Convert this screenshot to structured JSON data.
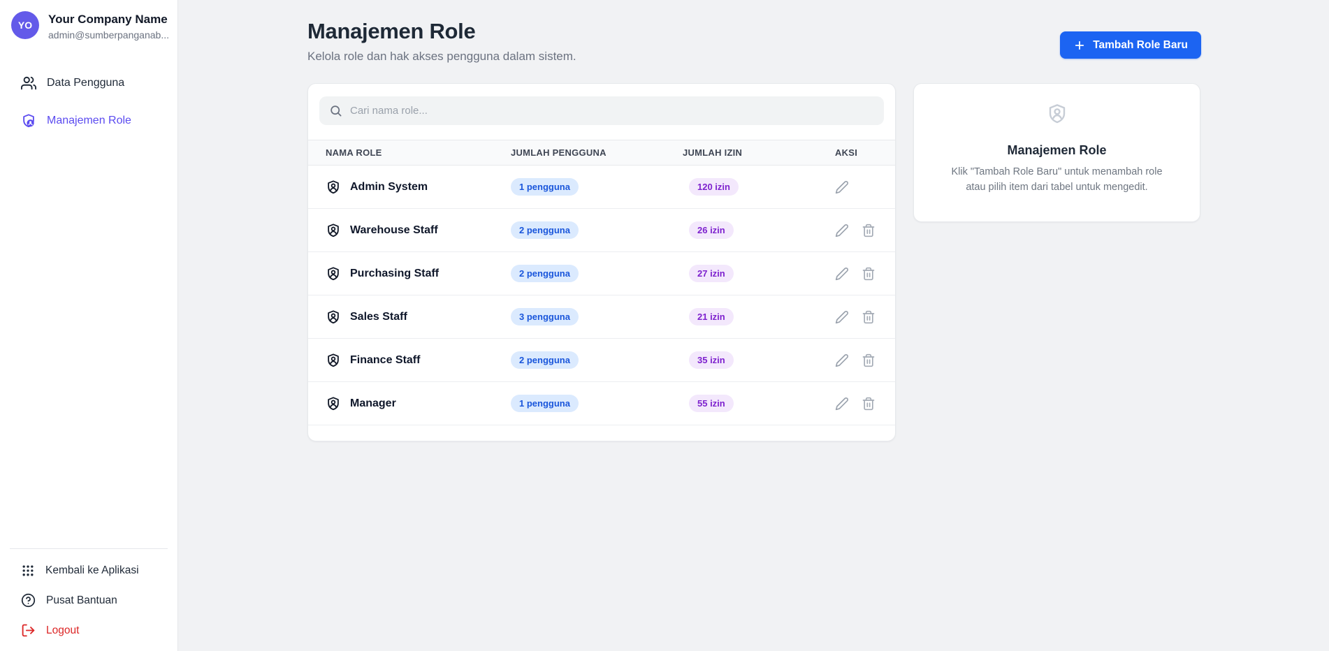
{
  "sidebar": {
    "profile": {
      "initials": "YO",
      "company_name": "Your Company Name",
      "email": "admin@sumberpanganab..."
    },
    "nav": [
      {
        "label": "Data Pengguna",
        "icon": "users-icon",
        "active": false
      },
      {
        "label": "Manajemen Role",
        "icon": "shield-user-icon",
        "active": true
      }
    ],
    "footer": [
      {
        "label": "Kembali ke Aplikasi",
        "icon": "grid-icon"
      },
      {
        "label": "Pusat Bantuan",
        "icon": "help-icon"
      },
      {
        "label": "Logout",
        "icon": "logout-icon"
      }
    ]
  },
  "header": {
    "title": "Manajemen Role",
    "subtitle": "Kelola role dan hak akses pengguna dalam sistem.",
    "add_button_label": "Tambah Role Baru"
  },
  "table": {
    "search_placeholder": "Cari nama role...",
    "columns": [
      "NAMA ROLE",
      "JUMLAH PENGGUNA",
      "JUMLAH IZIN",
      "AKSI"
    ],
    "rows": [
      {
        "name": "Admin System",
        "users": "1 pengguna",
        "permissions": "120 izin",
        "can_delete": false
      },
      {
        "name": "Warehouse Staff",
        "users": "2 pengguna",
        "permissions": "26 izin",
        "can_delete": true
      },
      {
        "name": "Purchasing Staff",
        "users": "2 pengguna",
        "permissions": "27 izin",
        "can_delete": true
      },
      {
        "name": "Sales Staff",
        "users": "3 pengguna",
        "permissions": "21 izin",
        "can_delete": true
      },
      {
        "name": "Finance Staff",
        "users": "2 pengguna",
        "permissions": "35 izin",
        "can_delete": true
      },
      {
        "name": "Manager",
        "users": "1 pengguna",
        "permissions": "55 izin",
        "can_delete": true
      }
    ]
  },
  "info_panel": {
    "title": "Manajemen Role",
    "description": "Klik \"Tambah Role Baru\" untuk menambah role atau pilih item dari tabel untuk mengedit."
  },
  "colors": {
    "accent_blue": "#1c64f2",
    "brand_purple": "#5b4bf0",
    "avatar_purple": "#635ae9",
    "badge_blue_bg": "#dbeafe",
    "badge_blue_text": "#1a56db",
    "badge_purple_bg": "#f3e8fc",
    "badge_purple_text": "#7e22ce",
    "logout_red": "#dc2626",
    "page_background": "#f1f2f4"
  }
}
